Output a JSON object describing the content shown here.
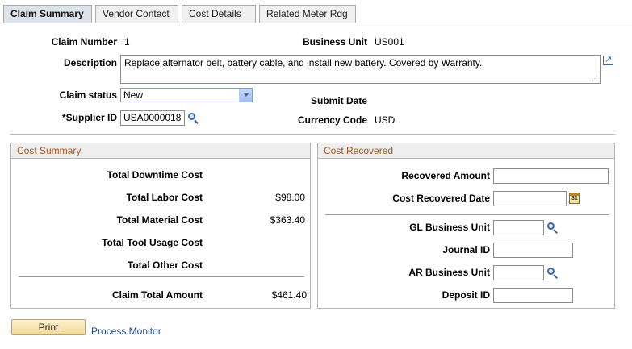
{
  "tabs": [
    {
      "label": "Claim Summary",
      "active": true
    },
    {
      "label": "Vendor Contact",
      "active": false
    },
    {
      "label": "Cost Details",
      "active": false
    },
    {
      "label": "Related Meter Rdg",
      "active": false
    }
  ],
  "header": {
    "claim_number_label": "Claim Number",
    "claim_number": "1",
    "business_unit_label": "Business Unit",
    "business_unit": "US001",
    "description_label": "Description",
    "description": "Replace alternator belt, battery cable, and install new battery. Covered by Warranty.",
    "claim_status_label": "Claim status",
    "claim_status": "New",
    "submit_date_label": "Submit Date",
    "supplier_id_label": "*Supplier ID",
    "supplier_id": "USA0000018",
    "currency_code_label": "Currency Code",
    "currency_code": "USD"
  },
  "cost_summary": {
    "title": "Cost Summary",
    "rows": [
      {
        "label": "Total Downtime Cost",
        "value": ""
      },
      {
        "label": "Total Labor Cost",
        "value": "$98.00"
      },
      {
        "label": "Total Material Cost",
        "value": "$363.40"
      },
      {
        "label": "Total Tool Usage Cost",
        "value": ""
      },
      {
        "label": "Total Other Cost",
        "value": ""
      }
    ],
    "total_label": "Claim Total Amount",
    "total_value": "$461.40"
  },
  "cost_recovered": {
    "title": "Cost Recovered",
    "recovered_amount_label": "Recovered Amount",
    "recovered_amount": "",
    "cost_recovered_date_label": "Cost Recovered Date",
    "cost_recovered_date": "",
    "calendar_icon_text": "31",
    "gl_business_unit_label": "GL Business Unit",
    "gl_business_unit": "",
    "journal_id_label": "Journal ID",
    "journal_id": "",
    "ar_business_unit_label": "AR Business Unit",
    "ar_business_unit": "",
    "deposit_id_label": "Deposit ID",
    "deposit_id": ""
  },
  "footer": {
    "print_label": "Print",
    "process_monitor_label": "Process Monitor"
  },
  "icons": {
    "lookup": "search-icon",
    "calendar": "calendar-icon",
    "expand": "expand-icon"
  }
}
